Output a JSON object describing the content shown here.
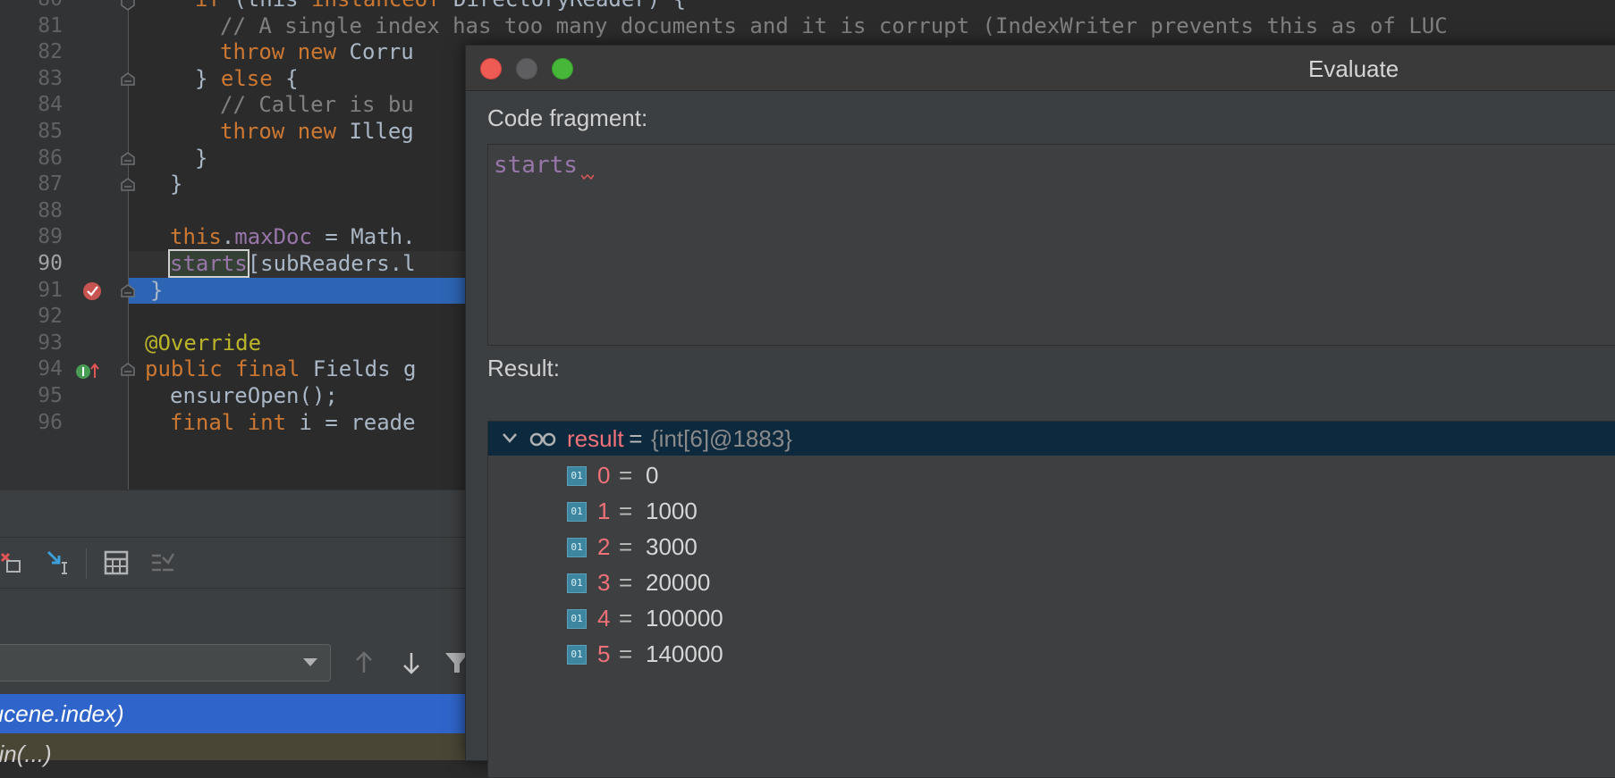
{
  "editor": {
    "lines": [
      {
        "num": "80",
        "tokens": [
          [
            "kw",
            "if "
          ],
          [
            "",
            "(this "
          ],
          [
            "kw",
            "instanceof "
          ],
          [
            "",
            "DirectoryReader) {"
          ]
        ]
      },
      {
        "num": "81",
        "tokens": [
          [
            "cm",
            "// A single index has too many documents and it is corrupt (IndexWriter prevents this as of LUC"
          ]
        ]
      },
      {
        "num": "82",
        "tokens": [
          [
            "kw",
            "throw new "
          ],
          [
            "",
            "Corru"
          ]
        ]
      },
      {
        "num": "83",
        "tokens": [
          [
            "",
            "} "
          ],
          [
            "kw",
            "else "
          ],
          [
            "",
            "{"
          ]
        ]
      },
      {
        "num": "84",
        "tokens": [
          [
            "cm",
            "// Caller is bu"
          ]
        ]
      },
      {
        "num": "85",
        "tokens": [
          [
            "kw",
            "throw new "
          ],
          [
            "",
            "Illeg"
          ]
        ]
      },
      {
        "num": "86",
        "tokens": [
          [
            "",
            "}"
          ]
        ]
      },
      {
        "num": "87",
        "tokens": [
          [
            "",
            "}"
          ]
        ]
      },
      {
        "num": "88",
        "tokens": []
      },
      {
        "num": "89",
        "tokens": [
          [
            "kw",
            "this"
          ],
          [
            "",
            "."
          ],
          [
            "fld",
            "maxDoc"
          ],
          [
            "",
            " = Math."
          ]
        ]
      },
      {
        "num": "90",
        "tokens": [
          [
            "sel",
            "starts"
          ],
          [
            "",
            "[subReaders.l"
          ]
        ]
      },
      {
        "num": "91",
        "tokens": [
          [
            "",
            "}"
          ]
        ]
      },
      {
        "num": "92",
        "tokens": []
      },
      {
        "num": "93",
        "tokens": [
          [
            "ann",
            "@Override"
          ]
        ]
      },
      {
        "num": "94",
        "tokens": [
          [
            "kw",
            "public final "
          ],
          [
            "",
            "Fields g"
          ]
        ]
      },
      {
        "num": "95",
        "tokens": [
          [
            "",
            "ensureOpen();"
          ]
        ]
      },
      {
        "num": "96",
        "tokens": [
          [
            "kw",
            "final int "
          ],
          [
            "",
            "i = reade"
          ]
        ]
      }
    ]
  },
  "debug": {
    "frames": {
      "selected": "lucene.index)",
      "next": "ain(...)"
    }
  },
  "evaluate": {
    "title": "Evaluate",
    "fragment_label": "Code fragment:",
    "fragment_code": "starts",
    "result_label": "Result:",
    "result": {
      "name": "result",
      "eq": " = ",
      "type": "{int[6]@1883}",
      "badge": "01",
      "items": [
        {
          "index": "0",
          "value": "0"
        },
        {
          "index": "1",
          "value": "1000"
        },
        {
          "index": "2",
          "value": "3000"
        },
        {
          "index": "3",
          "value": "20000"
        },
        {
          "index": "4",
          "value": "100000"
        },
        {
          "index": "5",
          "value": "140000"
        }
      ]
    }
  }
}
